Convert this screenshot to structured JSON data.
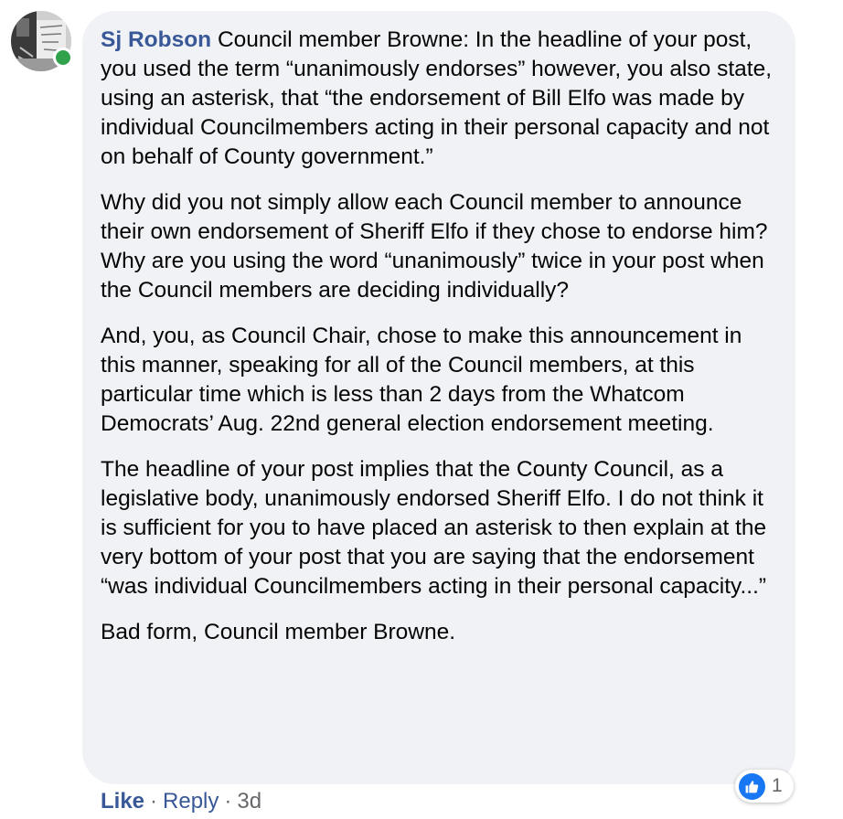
{
  "comment": {
    "author": "Sj Robson",
    "paragraphs": [
      "Council member Browne: In the headline of your post, you used the term “unanimously endorses” however, you also state, using an asterisk, that “the endorsement of Bill Elfo was made by individual Councilmembers acting in their personal capacity and not on behalf of County government.”",
      "Why did you not simply allow each Council member to announce their own endorsement of Sheriff Elfo if they chose to endorse him? Why are you using the word “unanimously” twice in your post when the Council members are deciding individually?",
      "And, you, as Council Chair, chose to make this announcement in this manner, speaking for all of the Council members, at this particular time which is less than 2 days from the Whatcom Democrats’ Aug. 22nd general election endorsement meeting.",
      "The headline of your post implies that the County Council, as a legislative body, unanimously endorsed Sheriff Elfo. I do not think it is sufficient for you to have placed an asterisk to then explain at the very bottom of your post that you are saying that the endorsement “was individual Councilmembers acting in their personal capacity...”",
      "Bad form, Council member Browne."
    ],
    "reaction_count": "1",
    "reaction_icon": "thumbs-up-icon"
  },
  "actions": {
    "like_label": "Like",
    "separator": "·",
    "reply_label": "Reply",
    "timestamp": "3d"
  },
  "colors": {
    "author_link": "#385898",
    "bubble_bg": "#f0f2f5",
    "online_status": "#31a24c",
    "like_reaction": "#1877f2",
    "meta_text": "#65676b"
  }
}
